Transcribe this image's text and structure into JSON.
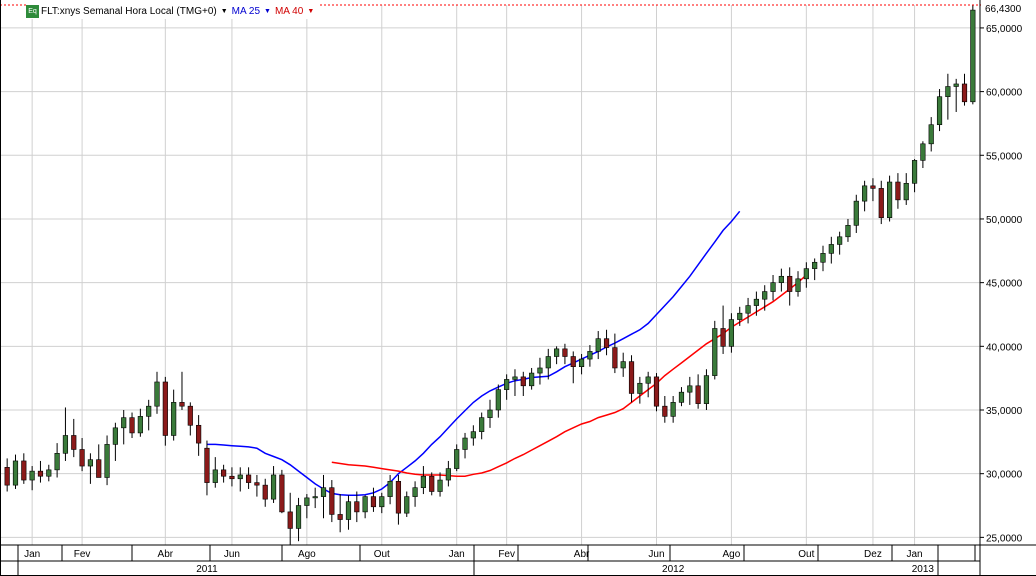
{
  "legend": {
    "instrument": "FLT:xnys Semanal Hora Local (TMG+0)",
    "ma25": "MA 25",
    "ma40": "MA 40",
    "icon_label": "Eq",
    "colors": {
      "ma25": "#0000ff",
      "ma40": "#ff0000",
      "up": "#3a7a3a",
      "down": "#8b1a1a"
    }
  },
  "chart_data": {
    "type": "candlestick",
    "title": "FLT:xnys Semanal Hora Local (TMG+0)",
    "last_value_label": "66,4300",
    "ylim": [
      24.4,
      66.8
    ],
    "y_ticks": [
      "25,0000",
      "30,0000",
      "35,0000",
      "40,0000",
      "45,0000",
      "50,0000",
      "55,0000",
      "60,0000",
      "65,0000"
    ],
    "y_tick_values": [
      25,
      30,
      35,
      40,
      45,
      50,
      55,
      60,
      65
    ],
    "months": [
      "Jan",
      "Fev",
      "Abr",
      "Jun",
      "Ago",
      "Out",
      "Jan",
      "Fev",
      "Abr",
      "Jun",
      "Ago",
      "Out",
      "Dez",
      "Jan"
    ],
    "month_weeks": [
      3,
      9,
      19,
      27,
      36,
      45,
      54,
      60,
      69,
      78,
      87,
      96,
      104,
      109
    ],
    "years": [
      "2011",
      "2012",
      "2013"
    ],
    "year_weeks": [
      24,
      80,
      110
    ],
    "grid": true,
    "candles": [
      [
        30.5,
        31.2,
        28.6,
        29.1
      ],
      [
        29.1,
        31.5,
        28.8,
        31.0
      ],
      [
        31.0,
        31.6,
        29.2,
        29.5
      ],
      [
        29.5,
        30.6,
        28.7,
        30.2
      ],
      [
        30.2,
        31.0,
        29.3,
        29.8
      ],
      [
        29.8,
        30.7,
        29.4,
        30.3
      ],
      [
        30.3,
        32.4,
        29.7,
        31.6
      ],
      [
        31.6,
        35.2,
        31.0,
        33.0
      ],
      [
        33.0,
        34.3,
        31.3,
        31.9
      ],
      [
        31.9,
        32.8,
        30.2,
        30.6
      ],
      [
        30.6,
        31.6,
        29.2,
        31.1
      ],
      [
        31.1,
        32.3,
        30.3,
        29.7
      ],
      [
        29.7,
        33.0,
        29.1,
        32.3
      ],
      [
        32.3,
        34.0,
        31.0,
        33.6
      ],
      [
        33.6,
        35.0,
        32.3,
        34.4
      ],
      [
        34.4,
        34.8,
        32.8,
        33.2
      ],
      [
        33.2,
        35.1,
        32.9,
        34.5
      ],
      [
        34.5,
        35.8,
        33.4,
        35.3
      ],
      [
        35.3,
        38.0,
        34.7,
        37.2
      ],
      [
        37.2,
        37.6,
        32.2,
        33.0
      ],
      [
        33.0,
        36.6,
        32.6,
        35.6
      ],
      [
        35.6,
        38.0,
        35.0,
        35.3
      ],
      [
        35.3,
        35.6,
        33.0,
        33.8
      ],
      [
        33.8,
        34.6,
        31.4,
        32.4
      ],
      [
        32.0,
        32.6,
        28.3,
        29.3
      ],
      [
        29.3,
        31.3,
        28.9,
        30.3
      ],
      [
        30.3,
        30.7,
        29.3,
        29.8
      ],
      [
        29.8,
        30.5,
        29.0,
        29.6
      ],
      [
        29.6,
        30.5,
        28.6,
        29.9
      ],
      [
        29.9,
        30.5,
        28.8,
        29.3
      ],
      [
        29.3,
        29.9,
        28.2,
        29.1
      ],
      [
        29.1,
        29.6,
        27.4,
        28.0
      ],
      [
        28.0,
        30.6,
        27.7,
        29.9
      ],
      [
        29.9,
        30.3,
        26.9,
        27.0
      ],
      [
        27.0,
        28.5,
        24.4,
        25.7
      ],
      [
        25.7,
        28.1,
        24.7,
        27.5
      ],
      [
        27.5,
        28.4,
        26.5,
        28.1
      ],
      [
        28.1,
        28.9,
        27.3,
        28.2
      ],
      [
        28.2,
        29.9,
        26.5,
        28.9
      ],
      [
        28.9,
        29.5,
        26.2,
        26.8
      ],
      [
        26.8,
        28.4,
        25.4,
        26.4
      ],
      [
        26.4,
        28.3,
        25.6,
        27.8
      ],
      [
        27.8,
        28.6,
        26.2,
        27.0
      ],
      [
        27.0,
        28.3,
        26.5,
        28.2
      ],
      [
        28.2,
        28.9,
        27.0,
        27.4
      ],
      [
        27.4,
        28.5,
        26.9,
        28.2
      ],
      [
        28.2,
        29.9,
        27.6,
        29.4
      ],
      [
        29.4,
        29.9,
        26.0,
        26.9
      ],
      [
        26.9,
        28.6,
        26.6,
        28.2
      ],
      [
        28.2,
        29.4,
        27.4,
        28.9
      ],
      [
        28.9,
        30.6,
        28.4,
        29.8
      ],
      [
        29.8,
        30.1,
        28.3,
        28.6
      ],
      [
        28.6,
        30.1,
        28.2,
        29.5
      ],
      [
        29.5,
        31.0,
        29.0,
        30.4
      ],
      [
        30.4,
        32.3,
        30.2,
        31.9
      ],
      [
        31.9,
        33.2,
        31.2,
        32.8
      ],
      [
        32.8,
        33.8,
        32.2,
        33.3
      ],
      [
        33.3,
        34.8,
        32.7,
        34.4
      ],
      [
        34.4,
        35.8,
        33.6,
        35.0
      ],
      [
        35.0,
        37.0,
        34.4,
        36.6
      ],
      [
        36.6,
        37.8,
        35.8,
        37.4
      ],
      [
        37.4,
        38.2,
        36.1,
        37.6
      ],
      [
        37.6,
        38.0,
        36.1,
        36.9
      ],
      [
        36.9,
        38.3,
        36.6,
        37.9
      ],
      [
        37.9,
        39.1,
        37.0,
        38.3
      ],
      [
        38.3,
        39.8,
        37.4,
        39.2
      ],
      [
        39.2,
        40.0,
        38.6,
        39.8
      ],
      [
        39.8,
        40.2,
        38.6,
        39.2
      ],
      [
        39.2,
        39.6,
        37.1,
        38.4
      ],
      [
        38.4,
        39.4,
        37.8,
        39.0
      ],
      [
        39.0,
        40.1,
        38.4,
        39.6
      ],
      [
        39.6,
        41.2,
        39.0,
        40.6
      ],
      [
        40.6,
        41.3,
        39.3,
        39.9
      ],
      [
        39.9,
        41.0,
        37.9,
        38.3
      ],
      [
        38.3,
        39.5,
        37.6,
        38.8
      ],
      [
        38.8,
        39.3,
        35.6,
        36.3
      ],
      [
        36.3,
        37.6,
        35.5,
        37.1
      ],
      [
        37.1,
        38.0,
        36.0,
        37.6
      ],
      [
        37.6,
        37.9,
        34.9,
        35.3
      ],
      [
        35.3,
        36.1,
        34.0,
        34.5
      ],
      [
        34.5,
        36.1,
        34.0,
        35.6
      ],
      [
        35.6,
        36.8,
        35.3,
        36.4
      ],
      [
        36.4,
        37.6,
        35.4,
        36.9
      ],
      [
        36.9,
        37.8,
        35.1,
        35.5
      ],
      [
        35.5,
        38.2,
        35.0,
        37.7
      ],
      [
        37.7,
        42.0,
        37.4,
        41.4
      ],
      [
        41.4,
        43.2,
        39.4,
        40.0
      ],
      [
        40.0,
        42.6,
        39.5,
        42.1
      ],
      [
        42.1,
        43.1,
        41.6,
        42.6
      ],
      [
        42.6,
        43.8,
        41.8,
        43.2
      ],
      [
        43.2,
        44.3,
        42.4,
        43.7
      ],
      [
        43.7,
        44.8,
        42.8,
        44.3
      ],
      [
        44.3,
        45.6,
        43.6,
        45.0
      ],
      [
        45.0,
        46.1,
        44.3,
        45.5
      ],
      [
        45.5,
        46.2,
        43.2,
        44.3
      ],
      [
        44.3,
        45.9,
        43.9,
        45.3
      ],
      [
        45.3,
        46.6,
        44.6,
        46.1
      ],
      [
        46.1,
        46.9,
        45.2,
        46.6
      ],
      [
        46.6,
        47.9,
        45.9,
        47.3
      ],
      [
        47.3,
        48.6,
        46.5,
        48.0
      ],
      [
        48.0,
        49.0,
        47.2,
        48.6
      ],
      [
        48.6,
        50.0,
        48.2,
        49.5
      ],
      [
        49.5,
        51.9,
        48.9,
        51.4
      ],
      [
        51.4,
        53.0,
        50.6,
        52.6
      ],
      [
        52.6,
        53.2,
        51.4,
        52.4
      ],
      [
        52.4,
        53.0,
        49.6,
        50.1
      ],
      [
        50.1,
        53.4,
        49.8,
        52.9
      ],
      [
        52.9,
        53.6,
        50.8,
        51.5
      ],
      [
        51.5,
        53.6,
        51.1,
        52.8
      ],
      [
        52.8,
        54.7,
        52.1,
        54.6
      ],
      [
        54.6,
        56.1,
        54.0,
        55.9
      ],
      [
        55.9,
        58.0,
        55.3,
        57.4
      ],
      [
        57.4,
        60.2,
        56.9,
        59.6
      ],
      [
        59.6,
        61.4,
        57.8,
        60.4
      ],
      [
        60.4,
        61.0,
        58.4,
        60.6
      ],
      [
        60.6,
        61.4,
        58.9,
        59.2
      ],
      [
        59.2,
        66.8,
        59.0,
        66.4
      ]
    ],
    "ma25": {
      "name": "MA 25",
      "start_week": 24,
      "values": [
        32.3,
        32.3,
        32.25,
        32.2,
        32.15,
        32.1,
        32.0,
        31.6,
        31.35,
        31.1,
        30.7,
        30.2,
        29.7,
        29.2,
        28.8,
        28.45,
        28.35,
        28.3,
        28.3,
        28.35,
        28.5,
        28.8,
        29.3,
        30.0,
        30.5,
        31.0,
        31.6,
        32.3,
        32.9,
        33.6,
        34.3,
        34.95,
        35.6,
        36.1,
        36.5,
        36.8,
        37.1,
        37.3,
        37.4,
        37.55,
        37.6,
        37.65,
        38.0,
        38.4,
        38.7,
        39.0,
        39.3,
        39.6,
        39.95,
        40.25,
        40.6,
        40.95,
        41.3,
        41.8,
        42.5,
        43.2,
        43.9,
        44.7,
        45.5,
        46.4,
        47.3,
        48.2,
        49.1,
        49.8,
        50.6
      ]
    },
    "ma40": {
      "name": "MA 40",
      "start_week": 39,
      "values": [
        30.9,
        30.8,
        30.7,
        30.65,
        30.6,
        30.5,
        30.4,
        30.3,
        30.2,
        30.05,
        29.95,
        29.9,
        29.9,
        29.9,
        29.85,
        29.8,
        29.8,
        29.95,
        30.05,
        30.25,
        30.55,
        30.85,
        31.2,
        31.5,
        31.85,
        32.2,
        32.55,
        32.9,
        33.3,
        33.6,
        33.9,
        34.1,
        34.4,
        34.6,
        34.8,
        35.1,
        35.6,
        36.1,
        36.6,
        37.1,
        37.7,
        38.2,
        38.7,
        39.2,
        39.7,
        40.2,
        40.6,
        41.0,
        41.5,
        41.9,
        42.3,
        42.7,
        43.1,
        43.5,
        44.0,
        44.5,
        45.0,
        45.6
      ]
    }
  }
}
